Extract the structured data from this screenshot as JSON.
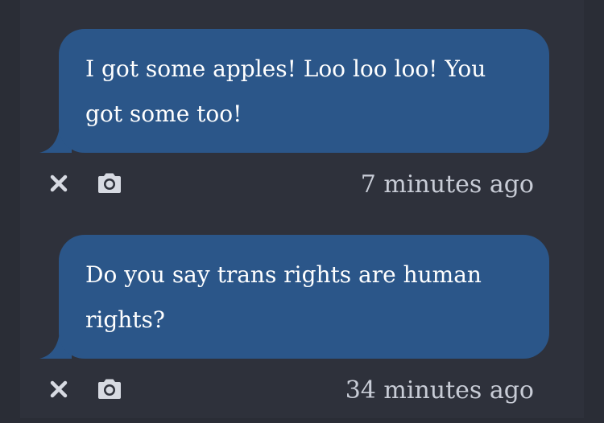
{
  "messages": [
    {
      "text": "I got some apples! Loo loo loo! You got some too!",
      "timestamp": "7 minutes ago"
    },
    {
      "text": "Do you say trans rights are human rights?",
      "timestamp": "34 minutes ago"
    }
  ],
  "icons": {
    "dismiss": "close-icon",
    "screenshot": "camera-icon"
  },
  "colors": {
    "background": "#2a2d36",
    "panel": "#2e313b",
    "bubble": "#2b5689",
    "bubble_text": "#ffffff",
    "meta_text": "#c8ccd6",
    "icon": "#d7dae2"
  }
}
